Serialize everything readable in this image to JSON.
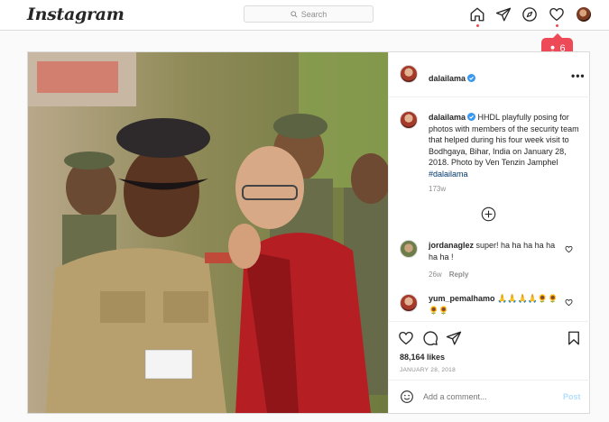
{
  "topbar": {
    "logo": "Instagram",
    "search_placeholder": "Search"
  },
  "notification": {
    "count": "6"
  },
  "post": {
    "author": "dalailama",
    "more": "•••",
    "caption_user": "dalailama",
    "caption_text": "HHDL playfully posing for photos with members of the security team that helped during his four week visit to Bodhgaya, Bihar, India on January 28, 2018. Photo by Ven Tenzin Jamphel",
    "caption_tag": "#dalailama",
    "caption_time": "173w",
    "comments": [
      {
        "user": "jordanaglez",
        "text": "super! ha ha ha ha ha ha ha !",
        "age": "26w",
        "reply": "Reply"
      },
      {
        "user": "yum_pemalhamo",
        "text": "🙏🙏🙏🙏🌻🌻🌻🌻"
      }
    ],
    "likes": "88,164 likes",
    "date": "JANUARY 28, 2018",
    "add_comment_placeholder": "Add a comment...",
    "post_label": "Post"
  },
  "colors": {
    "accent_red": "#ed4956",
    "link_blue": "#00376b",
    "verified_blue": "#3897f0",
    "post_btn": "#b2dffc"
  }
}
